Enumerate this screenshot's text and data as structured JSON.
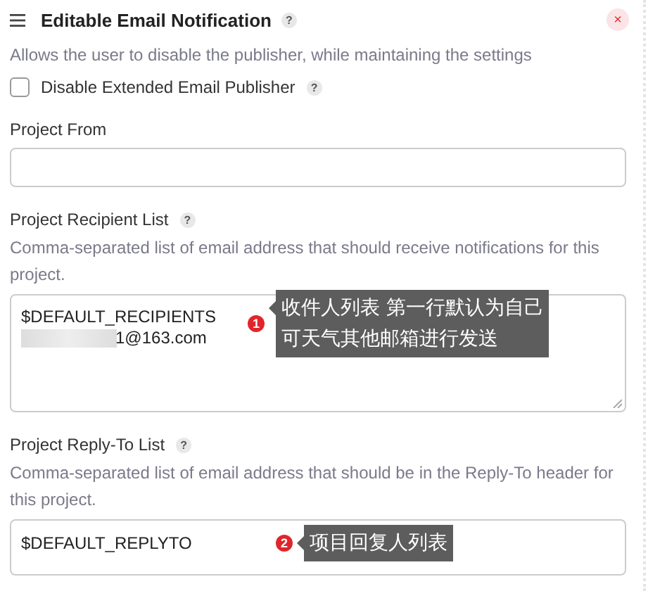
{
  "section": {
    "title": "Editable Email Notification",
    "help": "?",
    "close": "×",
    "description": "Allows the user to disable the publisher, while maintaining the settings",
    "checkbox": {
      "label": "Disable Extended Email Publisher",
      "checked": false,
      "help": "?"
    }
  },
  "fields": [
    {
      "kind": "input",
      "label": "Project From"
    },
    {
      "kind": "textarea",
      "label": "Project Recipient List",
      "help": "?",
      "description": "Comma-separated list of email address that should receive notifications for this project.",
      "value_lines": [
        "$DEFAULT_RECIPIENTS",
        "1@163.com"
      ],
      "annotation": {
        "number": "1",
        "lines": [
          "收件人列表 第一行默认为自己",
          "可天气其他邮箱进行发送"
        ]
      }
    },
    {
      "kind": "input",
      "label": "Project Reply-To List",
      "help": "?",
      "description": "Comma-separated list of email address that should be in the Reply-To header for this project.",
      "value": "$DEFAULT_REPLYTO",
      "annotation": {
        "number": "2",
        "lines": [
          "项目回复人列表"
        ]
      }
    }
  ]
}
